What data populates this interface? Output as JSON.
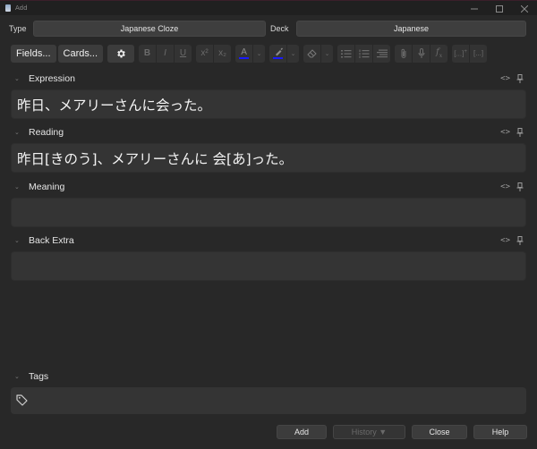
{
  "window": {
    "title": "Add",
    "controls": [
      "minimize",
      "maximize",
      "close"
    ]
  },
  "note_type": {
    "type_label": "Type",
    "type_value": "Japanese Cloze",
    "deck_label": "Deck",
    "deck_value": "Japanese"
  },
  "toolbar": {
    "fields_label": "Fields...",
    "cards_label": "Cards...",
    "settings_icon": "gear-icon",
    "format_buttons": [
      {
        "name": "bold",
        "glyph": "B"
      },
      {
        "name": "italic",
        "glyph": "I"
      },
      {
        "name": "underline",
        "glyph": "U"
      },
      {
        "name": "superscript",
        "glyph": "x²"
      },
      {
        "name": "subscript",
        "glyph": "x₂"
      }
    ],
    "text_color": "#1a1aff",
    "highlight_color": "#1a1aff",
    "list_buttons": [
      "unordered-list",
      "ordered-list",
      "alignment"
    ],
    "media_buttons": [
      "attachment",
      "record-audio",
      "mathjax"
    ],
    "cloze_buttons": [
      "cloze-new",
      "cloze-same"
    ]
  },
  "fields": [
    {
      "name": "Expression",
      "value": "昨日、メアリーさんに会った。"
    },
    {
      "name": "Reading",
      "value": "昨日[きのう]、メアリーさんに 会[あ]った。"
    },
    {
      "name": "Meaning",
      "value": ""
    },
    {
      "name": "Back Extra",
      "value": ""
    }
  ],
  "field_actions": {
    "html_toggle": "<>",
    "pin_icon": "pin-icon"
  },
  "tags": {
    "label": "Tags",
    "value": ""
  },
  "footer": {
    "add_label": "Add",
    "history_label": "History ▼",
    "close_label": "Close",
    "help_label": "Help"
  }
}
